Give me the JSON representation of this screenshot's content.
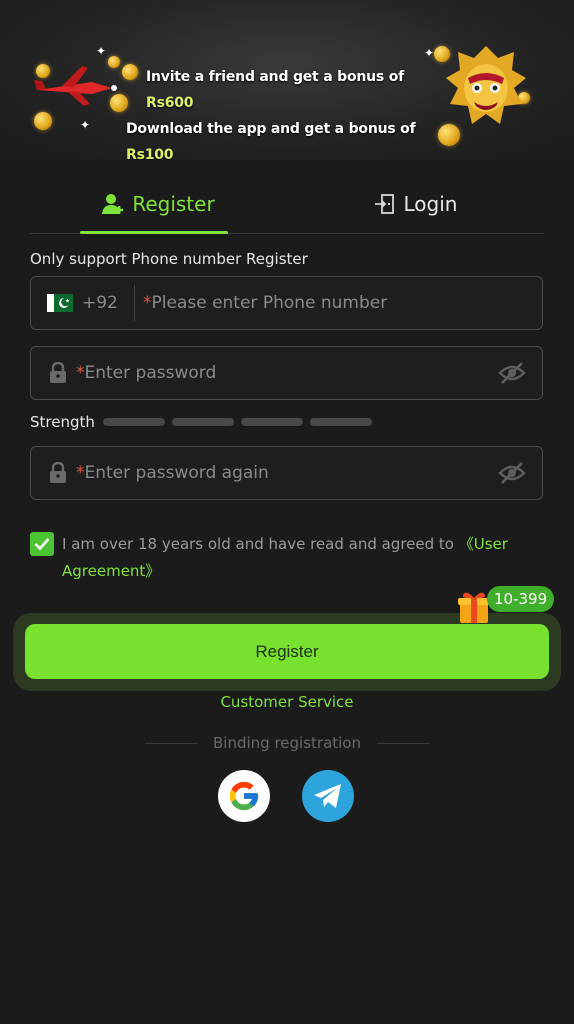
{
  "banner": {
    "line1_prefix": "Invite a friend and get a bonus of ",
    "line1_amount": "Rs600",
    "line2_prefix": "Download the app and get a bonus of ",
    "line2_amount": "Rs100",
    "amount_color": "#d9f26a"
  },
  "tabs": [
    {
      "label": "Register",
      "icon": "user-add-icon",
      "active": true
    },
    {
      "label": "Login",
      "icon": "login-door-icon",
      "active": false
    }
  ],
  "form": {
    "note": "Only support Phone number Register",
    "phone": {
      "flag": "pakistan-flag-icon",
      "country_code": "+92",
      "required_mark": "*",
      "placeholder": "Please enter Phone number"
    },
    "password": {
      "required_mark": "*",
      "placeholder": "Enter password"
    },
    "strength_label": "Strength",
    "strength_level": 0,
    "password_again": {
      "required_mark": "*",
      "placeholder": "Enter password again"
    },
    "agreement": {
      "checked": true,
      "text": "I am over 18 years old and have read and agreed to ",
      "link": "《User Agreement》"
    }
  },
  "register_button": {
    "label": "Register",
    "badge": "10-399"
  },
  "customer_service": "Customer Service",
  "binding_label": "Binding registration",
  "social": [
    {
      "name": "google-icon"
    },
    {
      "name": "telegram-icon"
    }
  ],
  "colors": {
    "accent": "#79e22f",
    "background": "#1b1b1b",
    "required": "#e0573f"
  }
}
